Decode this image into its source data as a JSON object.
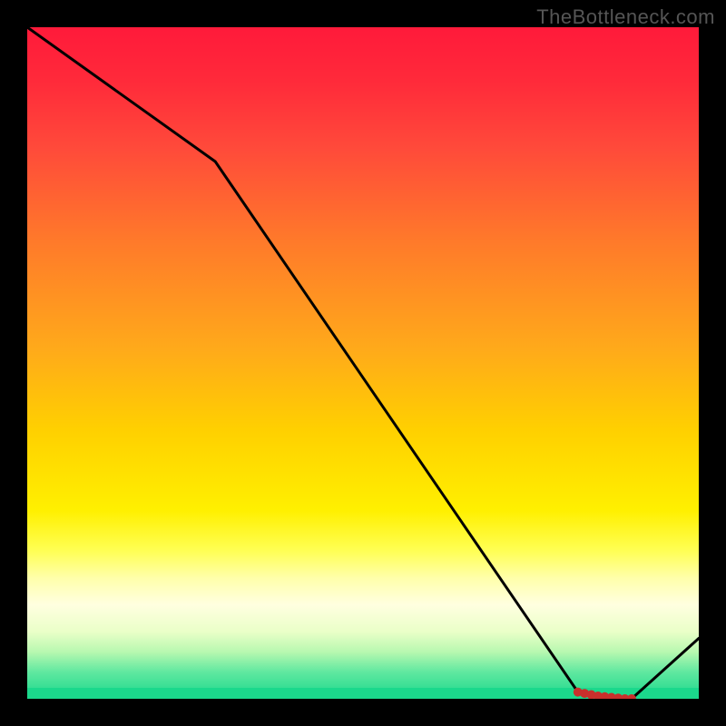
{
  "watermark": "TheBottleneck.com",
  "chart_data": {
    "type": "line",
    "title": "",
    "xlabel": "",
    "ylabel": "",
    "xlim": [
      0,
      100
    ],
    "ylim": [
      0,
      100
    ],
    "x": [
      0,
      28,
      82,
      90,
      100
    ],
    "values": [
      103,
      80,
      1,
      0,
      9
    ],
    "markers": {
      "x": [
        82,
        83,
        84,
        85,
        86,
        87,
        88,
        89,
        90
      ],
      "y": [
        1,
        0.8,
        0.6,
        0.4,
        0.3,
        0.2,
        0.1,
        0,
        0
      ]
    },
    "gradient_stops": [
      {
        "pos": 0,
        "color": "#ff1a3a"
      },
      {
        "pos": 50,
        "color": "#ffaa1a"
      },
      {
        "pos": 75,
        "color": "#ffff55"
      },
      {
        "pos": 100,
        "color": "#1bd88c"
      }
    ],
    "background": "#000000"
  }
}
